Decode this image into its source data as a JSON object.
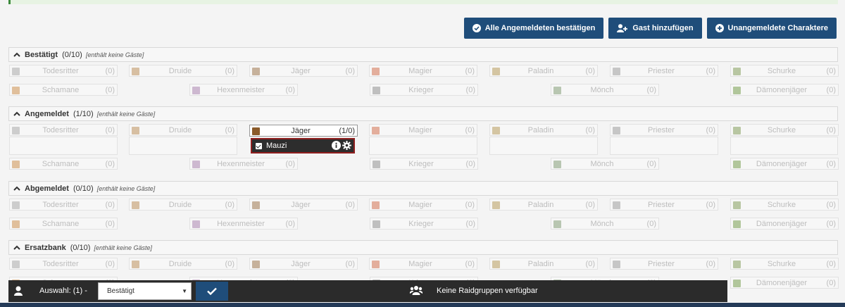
{
  "colors": {
    "primary_button": "#1f4d7a",
    "active_border": "#8f1f1f",
    "footer_bg": "#2b2b2b"
  },
  "actions": [
    {
      "label": "Alle Angemeldeten bestätigen",
      "icon": "check-circle-icon"
    },
    {
      "label": "Gast hinzufügen",
      "icon": "user-plus-icon"
    },
    {
      "label": "Unangemeldete Charaktere",
      "icon": "plus-circle-icon"
    }
  ],
  "sections": [
    {
      "title": "Bestätigt",
      "count": "(0/10)",
      "note": "[enthält keine Gäste]"
    },
    {
      "title": "Angemeldet",
      "count": "(1/10)",
      "note": "[enthält keine Gäste]"
    },
    {
      "title": "Abgemeldet",
      "count": "(0/10)",
      "note": "[enthält keine Gäste]"
    },
    {
      "title": "Ersatzbank",
      "count": "(0/10)",
      "note": "[enthält keine Gäste]"
    }
  ],
  "classes": [
    {
      "name": "Todesritter",
      "count": "(0)",
      "icon_color": "#9a9a9a"
    },
    {
      "name": "Druide",
      "count": "(0)",
      "icon_color": "#b07a3a"
    },
    {
      "name": "Jäger",
      "count": "(0)",
      "icon_color": "#8a5a2a"
    },
    {
      "name": "Magier",
      "count": "(0)",
      "icon_color": "#c9542d"
    },
    {
      "name": "Paladin",
      "count": "(0)",
      "icon_color": "#a8883a"
    },
    {
      "name": "Priester",
      "count": "(0)",
      "icon_color": "#8a8a8a"
    },
    {
      "name": "Schurke",
      "count": "(0)",
      "icon_color": "#6a8a3a"
    },
    {
      "name": "Schamane",
      "count": "(0)",
      "icon_color": "#c47a2a"
    },
    {
      "name": "Hexenmeister",
      "count": "(0)",
      "icon_color": "#9a6aa0"
    },
    {
      "name": "Krieger",
      "count": "(0)",
      "icon_color": "#7a7a7a"
    },
    {
      "name": "Mönch",
      "count": "(0)",
      "icon_color": "#6a8a5a"
    },
    {
      "name": "Dämonenjäger",
      "count": "(0)",
      "icon_color": "#5a8a2a"
    }
  ],
  "active_slot": {
    "name": "Jäger",
    "count": "(1/0)",
    "member": "Mauzi"
  },
  "footer": {
    "selection_label": "Auswahl: (1) -",
    "select_value": "Bestätigt",
    "group_text": "Keine Raidgruppen verfügbar"
  }
}
